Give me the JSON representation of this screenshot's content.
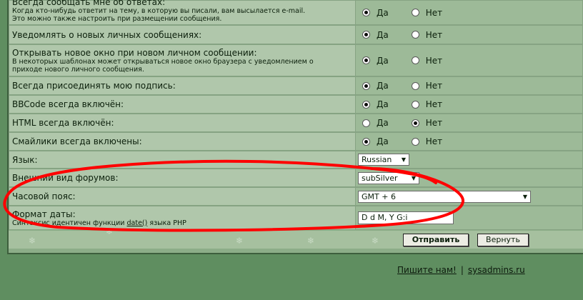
{
  "rows": [
    {
      "label": "Всегда сообщать мне об ответах:",
      "desc1": "Когда кто-нибудь ответит на тему, в которую вы писали, вам высылается e-mail.",
      "desc2": "Это можно также настроить при размещении сообщения.",
      "value": "yes"
    },
    {
      "label": "Уведомлять о новых личных сообщениях:",
      "value": "yes"
    },
    {
      "label": "Открывать новое окно при новом личном сообщении:",
      "desc1": "В некоторых шаблонах может открываться новое окно браузера с уведомлением о",
      "desc2": "приходе нового личного сообщения.",
      "value": "yes"
    },
    {
      "label": "Всегда присоединять мою подпись:",
      "value": "yes"
    },
    {
      "label": "BBCode всегда включён:",
      "value": "yes"
    },
    {
      "label": "HTML всегда включён:",
      "value": "no"
    },
    {
      "label": "Смайлики всегда включены:",
      "value": "yes"
    }
  ],
  "yes_label": "Да",
  "no_label": "Нет",
  "language": {
    "label": "Язык:",
    "value": "Russian"
  },
  "style": {
    "label": "Внешний вид форумов:",
    "value": "subSilver"
  },
  "timezone": {
    "label": "Часовой пояс:",
    "value": "GMT + 6"
  },
  "dateformat": {
    "label": "Формат даты:",
    "desc_prefix": "Синтаксис идентичен функции",
    "desc_link": "date()",
    "desc_suffix": "языка PHP",
    "value": "D d M, Y G:i"
  },
  "buttons": {
    "submit": "Отправить",
    "reset": "Вернуть"
  },
  "footer": {
    "contact": "Пишите нам!",
    "separator": "|",
    "site": "sysadmins.ru"
  },
  "colors": {
    "annotation": "#ff0000"
  }
}
